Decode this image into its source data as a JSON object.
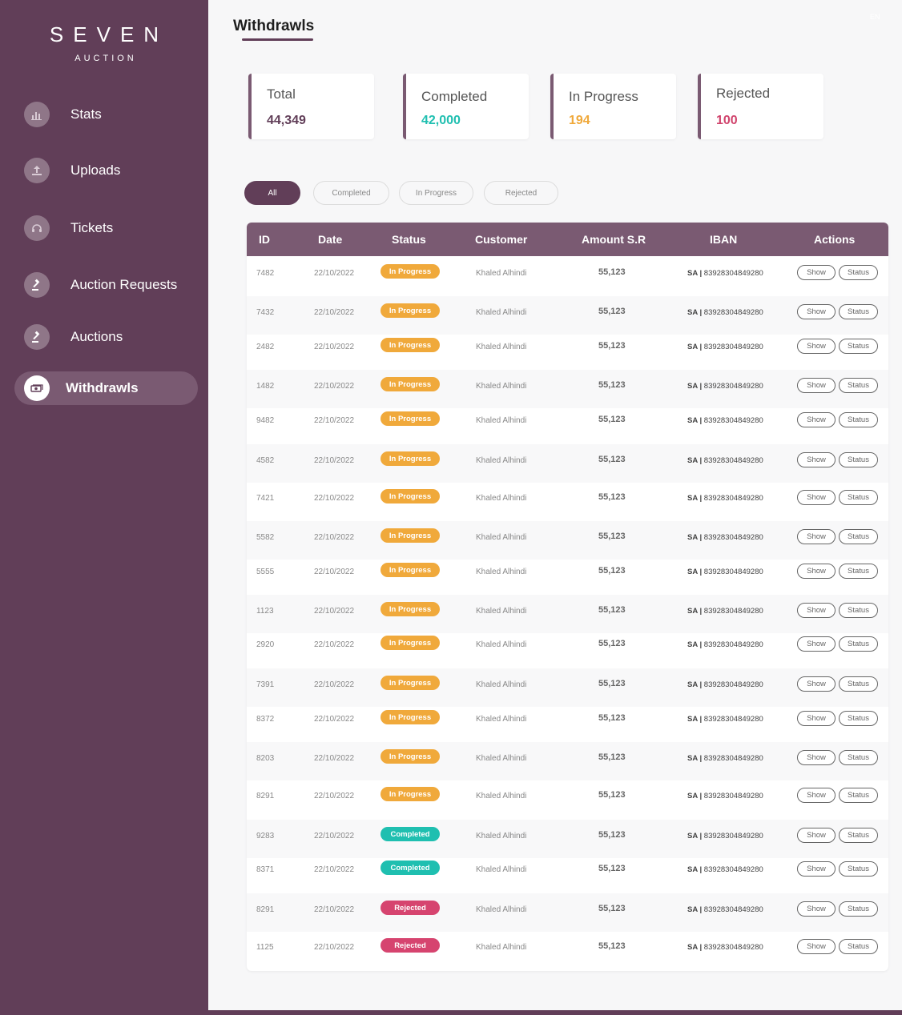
{
  "brand": {
    "name": "SEVEN",
    "subtitle": "AUCTION"
  },
  "sidebar": {
    "items": [
      {
        "label": "Stats",
        "icon": "bar-chart-icon",
        "active": false
      },
      {
        "label": "Uploads",
        "icon": "upload-icon",
        "active": false
      },
      {
        "label": "Tickets",
        "icon": "headset-icon",
        "active": false
      },
      {
        "label": "Auction Requests",
        "icon": "gavel-icon",
        "active": false
      },
      {
        "label": "Auctions",
        "icon": "gavel-icon",
        "active": false
      },
      {
        "label": "Withdrawls",
        "icon": "cash-icon",
        "active": true
      }
    ]
  },
  "header": {
    "title": "Withdrawls",
    "lang": "EN"
  },
  "stats": [
    {
      "label": "Total",
      "value": "44,349",
      "color": "#613e58"
    },
    {
      "label": "Completed",
      "value": "42,000",
      "color": "#1fbfb0"
    },
    {
      "label": "In Progress",
      "value": "194",
      "color": "#f0a93b"
    },
    {
      "label": "Rejected",
      "value": "100",
      "color": "#d0436c"
    }
  ],
  "filters": [
    "All",
    "Completed",
    "In Progress",
    "Rejected"
  ],
  "active_filter": "All",
  "status_colors": {
    "In Progress": "#f0a93b",
    "Completed": "#1fbfb0",
    "Rejected": "#d6446f"
  },
  "table": {
    "columns": [
      "ID",
      "Date",
      "Status",
      "Customer",
      "Amount S.R",
      "IBAN",
      "Actions"
    ],
    "show_label": "Show",
    "status_label": "Status",
    "rows": [
      {
        "id": "7482",
        "date": "22/10/2022",
        "status": "In Progress",
        "customer": "Khaled Alhindi",
        "amount": "55,123",
        "iban_prefix": "SA",
        "iban": "83928304849280"
      },
      {
        "id": "7432",
        "date": "22/10/2022",
        "status": "In Progress",
        "customer": "Khaled Alhindi",
        "amount": "55,123",
        "iban_prefix": "SA",
        "iban": "83928304849280"
      },
      {
        "id": "2482",
        "date": "22/10/2022",
        "status": "In Progress",
        "customer": "Khaled Alhindi",
        "amount": "55,123",
        "iban_prefix": "SA",
        "iban": "83928304849280"
      },
      {
        "id": "1482",
        "date": "22/10/2022",
        "status": "In Progress",
        "customer": "Khaled Alhindi",
        "amount": "55,123",
        "iban_prefix": "SA",
        "iban": "83928304849280"
      },
      {
        "id": "9482",
        "date": "22/10/2022",
        "status": "In Progress",
        "customer": "Khaled Alhindi",
        "amount": "55,123",
        "iban_prefix": "SA",
        "iban": "83928304849280"
      },
      {
        "id": "4582",
        "date": "22/10/2022",
        "status": "In Progress",
        "customer": "Khaled Alhindi",
        "amount": "55,123",
        "iban_prefix": "SA",
        "iban": "83928304849280"
      },
      {
        "id": "7421",
        "date": "22/10/2022",
        "status": "In Progress",
        "customer": "Khaled Alhindi",
        "amount": "55,123",
        "iban_prefix": "SA",
        "iban": "83928304849280"
      },
      {
        "id": "5582",
        "date": "22/10/2022",
        "status": "In Progress",
        "customer": "Khaled Alhindi",
        "amount": "55,123",
        "iban_prefix": "SA",
        "iban": "83928304849280"
      },
      {
        "id": "5555",
        "date": "22/10/2022",
        "status": "In Progress",
        "customer": "Khaled Alhindi",
        "amount": "55,123",
        "iban_prefix": "SA",
        "iban": "83928304849280"
      },
      {
        "id": "1123",
        "date": "22/10/2022",
        "status": "In Progress",
        "customer": "Khaled Alhindi",
        "amount": "55,123",
        "iban_prefix": "SA",
        "iban": "83928304849280"
      },
      {
        "id": "2920",
        "date": "22/10/2022",
        "status": "In Progress",
        "customer": "Khaled Alhindi",
        "amount": "55,123",
        "iban_prefix": "SA",
        "iban": "83928304849280"
      },
      {
        "id": "7391",
        "date": "22/10/2022",
        "status": "In Progress",
        "customer": "Khaled Alhindi",
        "amount": "55,123",
        "iban_prefix": "SA",
        "iban": "83928304849280"
      },
      {
        "id": "8372",
        "date": "22/10/2022",
        "status": "In Progress",
        "customer": "Khaled Alhindi",
        "amount": "55,123",
        "iban_prefix": "SA",
        "iban": "83928304849280"
      },
      {
        "id": "8203",
        "date": "22/10/2022",
        "status": "In Progress",
        "customer": "Khaled Alhindi",
        "amount": "55,123",
        "iban_prefix": "SA",
        "iban": "83928304849280"
      },
      {
        "id": "8291",
        "date": "22/10/2022",
        "status": "In Progress",
        "customer": "Khaled Alhindi",
        "amount": "55,123",
        "iban_prefix": "SA",
        "iban": "83928304849280"
      },
      {
        "id": "9283",
        "date": "22/10/2022",
        "status": "Completed",
        "customer": "Khaled Alhindi",
        "amount": "55,123",
        "iban_prefix": "SA",
        "iban": "83928304849280"
      },
      {
        "id": "8371",
        "date": "22/10/2022",
        "status": "Completed",
        "customer": "Khaled Alhindi",
        "amount": "55,123",
        "iban_prefix": "SA",
        "iban": "83928304849280"
      },
      {
        "id": "8291",
        "date": "22/10/2022",
        "status": "Rejected",
        "customer": "Khaled Alhindi",
        "amount": "55,123",
        "iban_prefix": "SA",
        "iban": "83928304849280"
      },
      {
        "id": "1125",
        "date": "22/10/2022",
        "status": "Rejected",
        "customer": "Khaled Alhindi",
        "amount": "55,123",
        "iban_prefix": "SA",
        "iban": "83928304849280"
      }
    ]
  }
}
